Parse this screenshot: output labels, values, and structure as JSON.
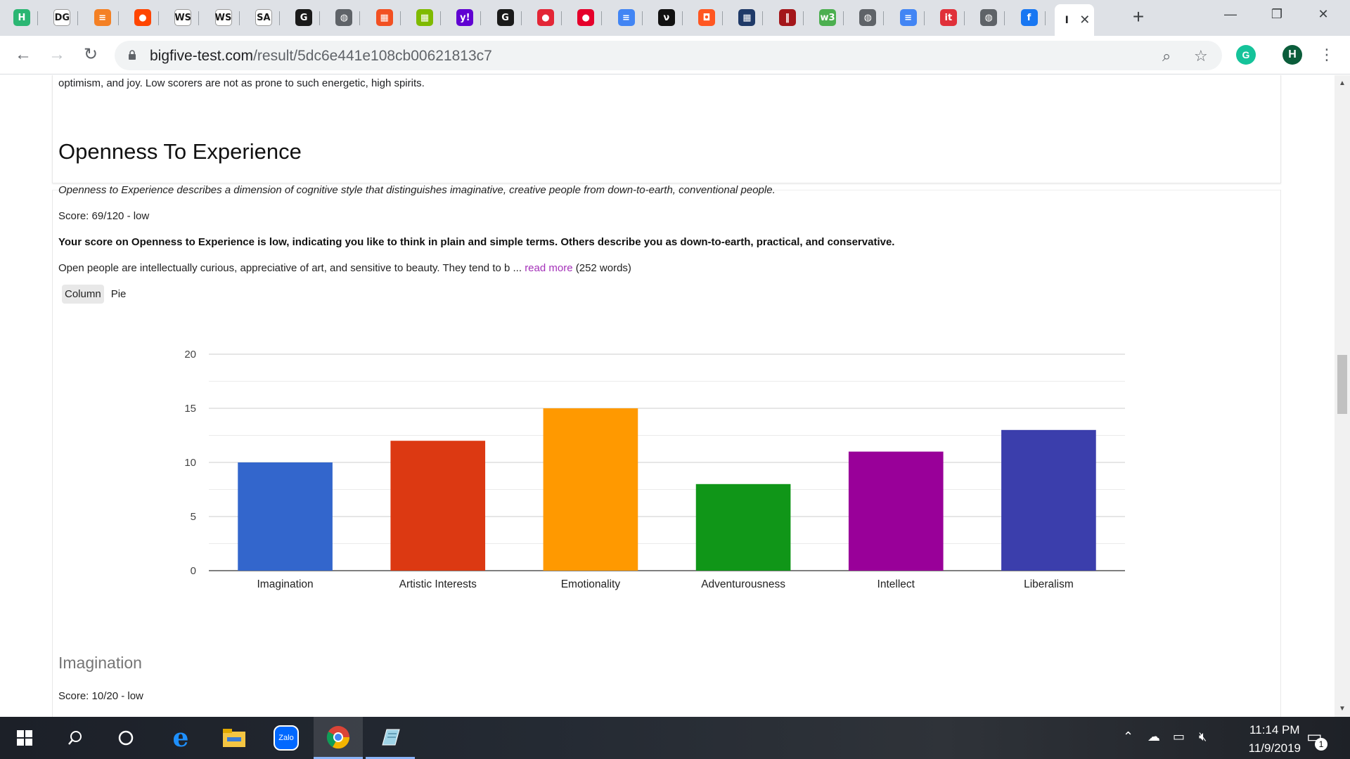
{
  "browser": {
    "url_host": "bigfive-test.com",
    "url_path": "/result/5dc6e441e108cb00621813c7",
    "tabs": [
      {
        "icon": "h-icon",
        "glyph": "H",
        "color": "#2bb673"
      },
      {
        "icon": "dg-icon",
        "glyph": "DG",
        "color": "#ffffff"
      },
      {
        "icon": "stackoverflow-icon",
        "glyph": "≡",
        "color": "#f48024"
      },
      {
        "icon": "reddit-icon",
        "glyph": "●",
        "color": "#ff4500"
      },
      {
        "icon": "wks-icon",
        "glyph": "WS",
        "color": "#ffffff"
      },
      {
        "icon": "wks-icon",
        "glyph": "WS",
        "color": "#ffffff"
      },
      {
        "icon": "sa-icon",
        "glyph": "SA",
        "color": "#ffffff"
      },
      {
        "icon": "g-icon",
        "glyph": "G",
        "color": "#1a1a1a"
      },
      {
        "icon": "globe-icon",
        "glyph": "◍",
        "color": "#5f6368"
      },
      {
        "icon": "microsoft-icon",
        "glyph": "▦",
        "color": "#f25022"
      },
      {
        "icon": "microsoft-icon",
        "glyph": "▦",
        "color": "#7fba00"
      },
      {
        "icon": "yahoo-icon",
        "glyph": "y!",
        "color": "#6001d2"
      },
      {
        "icon": "g-icon",
        "glyph": "G",
        "color": "#1a1a1a"
      },
      {
        "icon": "red-blob-icon",
        "glyph": "●",
        "color": "#e32636"
      },
      {
        "icon": "red-blob-icon",
        "glyph": "●",
        "color": "#e5002b"
      },
      {
        "icon": "docs-icon",
        "glyph": "≡",
        "color": "#4285f4"
      },
      {
        "icon": "dark-circle-icon",
        "glyph": "ν",
        "color": "#111111"
      },
      {
        "icon": "orange-icon",
        "glyph": "◘",
        "color": "#ff5722"
      },
      {
        "icon": "grid-icon",
        "glyph": "▦",
        "color": "#1f3a68"
      },
      {
        "icon": "bars-icon",
        "glyph": "‖",
        "color": "#a4161a"
      },
      {
        "icon": "w3-icon",
        "glyph": "w3",
        "color": "#4caf50"
      },
      {
        "icon": "globe-icon",
        "glyph": "◍",
        "color": "#5f6368"
      },
      {
        "icon": "docs-icon",
        "glyph": "≡",
        "color": "#4285f4"
      },
      {
        "icon": "it-icon",
        "glyph": "it",
        "color": "#e0303a"
      },
      {
        "icon": "globe-icon",
        "glyph": "◍",
        "color": "#5f6368"
      },
      {
        "icon": "facebook-icon",
        "glyph": "f",
        "color": "#1877f2"
      }
    ],
    "active_tab_glyph": "I",
    "profile_initial": "H",
    "grammarly_initial": "G"
  },
  "page": {
    "previous_tail": "optimism, and joy. Low scorers are not as prone to such energetic, high spirits.",
    "domain": {
      "title": "Openness To Experience",
      "description": "Openness to Experience describes a dimension of cognitive style that distinguishes imaginative, creative people from down-to-earth, conventional people.",
      "score_text": "Score: 69/120 - low",
      "summary": "Your score on Openness to Experience is low, indicating you like to think in plain and simple terms. Others describe you as down-to-earth, practical, and conservative.",
      "paragraph": "Open people are intellectually curious, appreciative of art, and sensitive to beauty. They tend to b",
      "ellipsis": " ... ",
      "read_more": "read more",
      "word_count": " (252 words)"
    },
    "chart_toggle": {
      "column": "Column",
      "pie": "Pie"
    },
    "facet": {
      "title": "Imagination",
      "score_text": "Score: 10/20 - low"
    }
  },
  "chart_data": {
    "type": "bar",
    "categories": [
      "Imagination",
      "Artistic Interests",
      "Emotionality",
      "Adventurousness",
      "Intellect",
      "Liberalism"
    ],
    "values": [
      10,
      12,
      15,
      8,
      11,
      13
    ],
    "colors": [
      "#3366cc",
      "#dc3912",
      "#ff9900",
      "#109618",
      "#990099",
      "#3b3eac"
    ],
    "yticks": [
      0,
      5,
      10,
      15,
      20
    ],
    "ylim": [
      0,
      20
    ],
    "grid": true,
    "title": "",
    "xlabel": "",
    "ylabel": ""
  },
  "taskbar": {
    "time": "11:14 PM",
    "date": "11/9/2019",
    "notification_count": "1",
    "zalo_label": "Zalo"
  }
}
